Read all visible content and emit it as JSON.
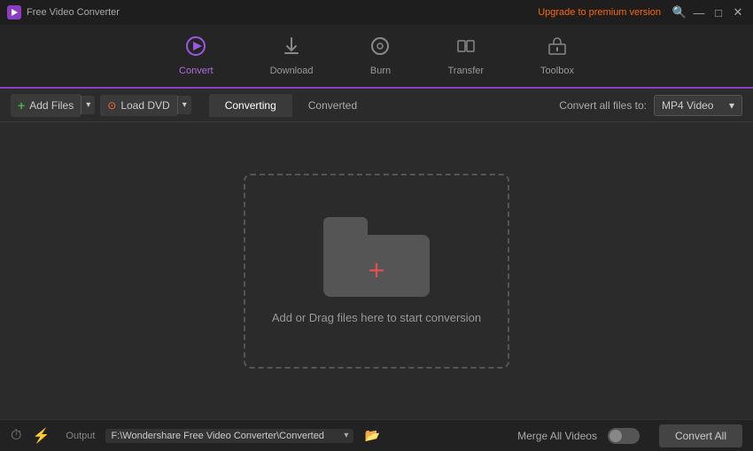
{
  "titleBar": {
    "appTitle": "Free Video Converter",
    "upgradeLabel": "Upgrade to premium version",
    "searchIcon": "🔍",
    "minimizeIcon": "—",
    "maximizeIcon": "□",
    "closeIcon": "✕"
  },
  "nav": {
    "items": [
      {
        "id": "convert",
        "label": "Convert",
        "icon": "▶",
        "active": true
      },
      {
        "id": "download",
        "label": "Download",
        "icon": "⬇",
        "active": false
      },
      {
        "id": "burn",
        "label": "Burn",
        "icon": "⊙",
        "active": false
      },
      {
        "id": "transfer",
        "label": "Transfer",
        "icon": "⇄",
        "active": false
      },
      {
        "id": "toolbox",
        "label": "Toolbox",
        "icon": "⚙",
        "active": false
      }
    ]
  },
  "toolbar": {
    "addFilesLabel": "Add Files",
    "loadDvdLabel": "Load DVD",
    "convertingTab": "Converting",
    "convertedTab": "Converted",
    "formatLabel": "Convert all files to:",
    "formatValue": "MP4 Video"
  },
  "dropZone": {
    "text": "Add or Drag files here to start conversion"
  },
  "statusBar": {
    "outputLabel": "Output",
    "outputPath": "F:\\Wondershare Free Video Converter\\Converted",
    "mergeLabel": "Merge All Videos",
    "convertAllLabel": "Convert All"
  }
}
